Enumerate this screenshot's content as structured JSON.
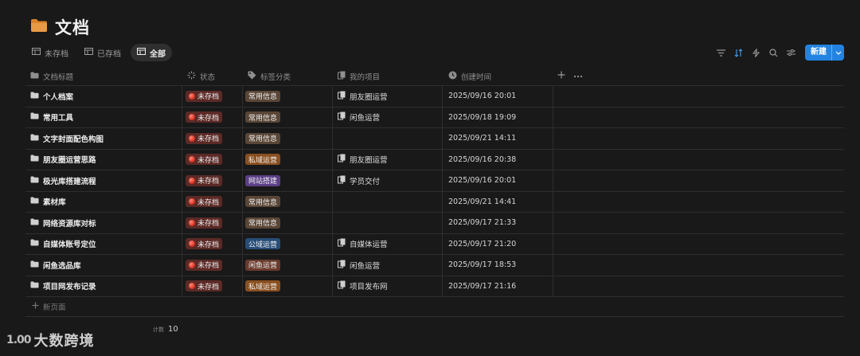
{
  "page": {
    "title": "文档"
  },
  "views": [
    {
      "label": "未存档",
      "active": false
    },
    {
      "label": "已存档",
      "active": false
    },
    {
      "label": "全部",
      "active": true
    }
  ],
  "toolbar": {
    "new_label": "新建"
  },
  "columns": [
    "文档标题",
    "状态",
    "标签分类",
    "我的项目",
    "创建时间"
  ],
  "tag_colors": {
    "常用信息": "#5a4636",
    "私域运营": "#8a4f1f",
    "网站搭建": "#5c3f86",
    "公域运营": "#274d78",
    "闲鱼运营": "#6a3a2c"
  },
  "rows": [
    {
      "title": "个人档案",
      "status": "未存档",
      "tag": "常用信息",
      "project": "朋友圈运营",
      "created": "2025/09/16 20:01"
    },
    {
      "title": "常用工具",
      "status": "未存档",
      "tag": "常用信息",
      "project": "闲鱼运营",
      "created": "2025/09/18 19:09"
    },
    {
      "title": "文字封面配色构图",
      "status": "未存档",
      "tag": "常用信息",
      "project": "",
      "created": "2025/09/21 14:11"
    },
    {
      "title": "朋友圈运营思路",
      "status": "未存档",
      "tag": "私域运营",
      "project": "朋友圈运营",
      "created": "2025/09/16 20:38"
    },
    {
      "title": "极光库搭建流程",
      "status": "未存档",
      "tag": "网站搭建",
      "project": "学员交付",
      "created": "2025/09/16 20:01"
    },
    {
      "title": "素材库",
      "status": "未存档",
      "tag": "常用信息",
      "project": "",
      "created": "2025/09/21 14:41"
    },
    {
      "title": "网络资源库对标",
      "status": "未存档",
      "tag": "常用信息",
      "project": "",
      "created": "2025/09/17 21:33"
    },
    {
      "title": "自媒体账号定位",
      "status": "未存档",
      "tag": "公域运营",
      "project": "自媒体运营",
      "created": "2025/09/17 21:20"
    },
    {
      "title": "闲鱼选品库",
      "status": "未存档",
      "tag": "闲鱼运营",
      "project": "闲鱼运营",
      "created": "2025/09/17 18:53"
    },
    {
      "title": "项目网发布记录",
      "status": "未存档",
      "tag": "私域运营",
      "project": "项目发布网",
      "created": "2025/09/17 21:16"
    }
  ],
  "new_page_label": "新页面",
  "footer": {
    "count_label": "计数",
    "count_value": "10",
    "brand": "大数跨境",
    "brand_mark": "1.00"
  },
  "colors": {
    "accent": "#2383e2",
    "folder": "#d9822b",
    "background": "#191919"
  }
}
